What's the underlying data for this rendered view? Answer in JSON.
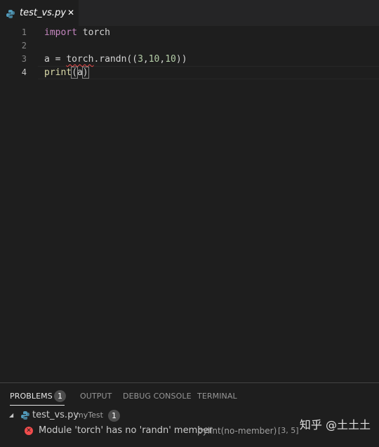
{
  "tab": {
    "file_name": "test_vs.py",
    "close_glyph": "✕"
  },
  "editor": {
    "line_numbers": [
      "1",
      "2",
      "3",
      "4"
    ],
    "code": {
      "l1_kw": "import",
      "l1_rest": " torch",
      "l3_a": "a = ",
      "l3_torch": "torch",
      "l3_dot": ".",
      "l3_fn": "randn",
      "l3_open": "((",
      "l3_n1": "3",
      "l3_c1": ",",
      "l3_n2": "10",
      "l3_c2": ",",
      "l3_n3": "10",
      "l3_close": "))",
      "l4_fn": "print",
      "l4_open": "(",
      "l4_arg": "a",
      "l4_close": ")"
    }
  },
  "panel": {
    "tabs": [
      {
        "label": "PROBLEMS"
      },
      {
        "label": "OUTPUT"
      },
      {
        "label": "DEBUG CONSOLE"
      },
      {
        "label": "TERMINAL"
      }
    ],
    "problems_count": "1",
    "file_group": {
      "file_name": "test_vs.py",
      "folder": "myTest",
      "count": "1"
    },
    "problem": {
      "message": "Module 'torch' has no 'randn' member",
      "source": "pylint(no-member)",
      "position": "[3, 5]"
    }
  },
  "watermark": "知乎 @土土土",
  "colors": {
    "keyword": "#c586c0",
    "function": "#dcdcaa",
    "number": "#b5cea8",
    "error": "#f14c4c"
  }
}
